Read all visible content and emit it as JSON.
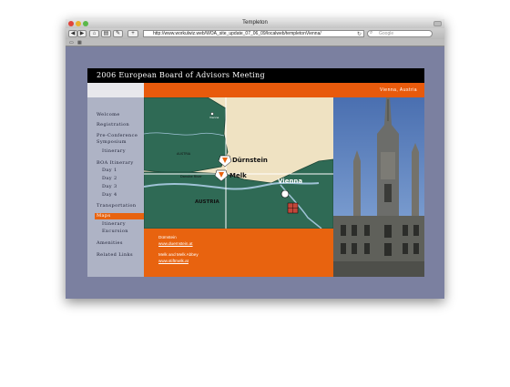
{
  "window": {
    "title": "Templeton"
  },
  "browser": {
    "url": "http://www.workulwiz.web/WOA_site_update_07_06_09/localweb/templetonVienna/",
    "search_placeholder": "Google"
  },
  "site": {
    "header_title": "2006 European Board of Advisors Meeting",
    "location": "Vienna, Austria",
    "nav": [
      {
        "label": "Welcome"
      },
      {
        "label": "Registration"
      },
      {
        "label": "Pre-Conference"
      },
      {
        "label": "Symposium"
      },
      {
        "label": "Itinerary"
      },
      {
        "label": "BOA Itinerary"
      },
      {
        "label": "Day 1"
      },
      {
        "label": "Day 2"
      },
      {
        "label": "Day 3"
      },
      {
        "label": "Day 4"
      },
      {
        "label": "Transportation"
      },
      {
        "label": "Maps"
      },
      {
        "label": "Itinerary"
      },
      {
        "label": "Excursion"
      },
      {
        "label": "Amenities"
      },
      {
        "label": "Related Links"
      }
    ],
    "map": {
      "austria_small": "AUSTRIA",
      "austria_large": "AUSTRIA",
      "durnstein": "Dürnstein",
      "melk": "Melk",
      "vienna": "Vienna",
      "danube": "Danube River",
      "small_city": "Vienna"
    },
    "info": {
      "item1_title": "Dürnstein",
      "item1_link": "www.duernstein.at",
      "item2_title": "Melk and Melk Abbey",
      "item2_link": "www.stiftmelk.at"
    }
  },
  "colors": {
    "accent": "#e8630f",
    "nav_bg": "#aeb3c5",
    "map_green": "#2f6a55",
    "page_bg": "#7b80a0"
  }
}
